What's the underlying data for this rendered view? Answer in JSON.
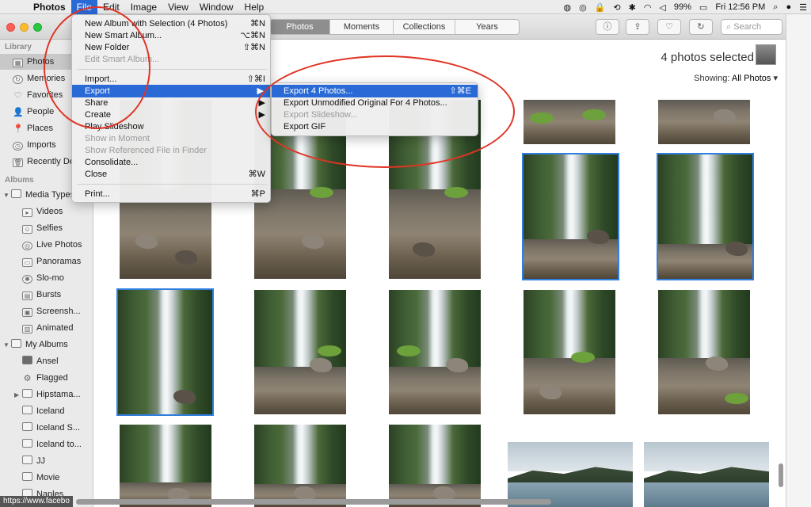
{
  "menubar": {
    "app": "Photos",
    "menus": [
      "File",
      "Edit",
      "Image",
      "View",
      "Window",
      "Help"
    ],
    "battery": "99%",
    "clock": "Fri 12:56 PM"
  },
  "toolbar": {
    "tabs": [
      "Photos",
      "Moments",
      "Collections",
      "Years"
    ],
    "search_placeholder": "Search"
  },
  "sidebar": {
    "library_header": "Library",
    "library_items": [
      "Photos",
      "Memories",
      "Favorites",
      "People",
      "Places",
      "Imports",
      "Recently De"
    ],
    "albums_header": "Albums",
    "media_group": "Media Types",
    "media_items": [
      "Videos",
      "Selfies",
      "Live Photos",
      "Panoramas",
      "Slo-mo",
      "Bursts",
      "Screensh...",
      "Animated"
    ],
    "my_albums": "My Albums",
    "album_items": [
      "Ansel",
      "Flagged",
      "Hipstama...",
      "Iceland",
      "Iceland S...",
      "Iceland to...",
      "JJ",
      "Movie",
      "Naples"
    ]
  },
  "main": {
    "selected_text": "4 photos selected",
    "showing_label": "Showing:",
    "showing_value": "All Photos"
  },
  "file_menu": {
    "items": [
      {
        "label": "New Album with Selection (4 Photos)",
        "shortcut": "⌘N",
        "disabled": false
      },
      {
        "label": "New Smart Album...",
        "shortcut": "⌥⌘N",
        "disabled": false
      },
      {
        "label": "New Folder",
        "shortcut": "⇧⌘N",
        "disabled": false
      },
      {
        "label": "Edit Smart Album...",
        "shortcut": "",
        "disabled": true
      },
      {
        "label": "Import...",
        "shortcut": "⇧⌘I",
        "disabled": false
      },
      {
        "label": "Export",
        "shortcut": "",
        "disabled": false
      },
      {
        "label": "Share",
        "shortcut": "",
        "disabled": false
      },
      {
        "label": "Create",
        "shortcut": "",
        "disabled": false
      },
      {
        "label": "Play Slideshow",
        "shortcut": "",
        "disabled": false
      },
      {
        "label": "Show in Moment",
        "shortcut": "",
        "disabled": true
      },
      {
        "label": "Show Referenced File in Finder",
        "shortcut": "",
        "disabled": true
      },
      {
        "label": "Consolidate...",
        "shortcut": "",
        "disabled": false
      },
      {
        "label": "Close",
        "shortcut": "⌘W",
        "disabled": false
      },
      {
        "label": "Print...",
        "shortcut": "⌘P",
        "disabled": false
      }
    ]
  },
  "export_menu": {
    "items": [
      {
        "label": "Export 4 Photos...",
        "shortcut": "⇧⌘E",
        "disabled": false
      },
      {
        "label": "Export Unmodified Original For 4 Photos...",
        "shortcut": "",
        "disabled": false
      },
      {
        "label": "Export Slideshow...",
        "shortcut": "",
        "disabled": true
      },
      {
        "label": "Export GIF",
        "shortcut": "",
        "disabled": false
      }
    ]
  },
  "status_url": "https://www.facebo",
  "colors": {
    "accent": "#2a6ad6",
    "annotation": "#e03425",
    "selection": "#2f7fe0"
  }
}
